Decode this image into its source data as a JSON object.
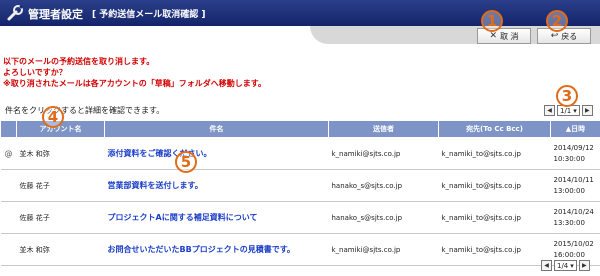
{
  "header": {
    "title": "管理者設定",
    "subtitle": "[ 予約送信メール取消確認 ]",
    "icon": "wrench-icon"
  },
  "buttons": {
    "cancel": "取 消",
    "back": "戻る"
  },
  "message": {
    "line1": "以下のメールの予約送信を取り消します。",
    "line2": "よろしいですか？",
    "line3": "※取り消されたメールは各アカウントの「草稿」フォルダへ移動します。"
  },
  "hint": "件名をクリックすると詳細を確認できます。",
  "pagination": {
    "value": "1/1"
  },
  "pagination_bottom": {
    "value": "1/4"
  },
  "columns": {
    "account": "アカウント名",
    "subject": "件名",
    "from": "送信者",
    "to": "宛先(To Cc Bcc)",
    "date": "▲日時"
  },
  "rows": [
    {
      "attach": "@",
      "account": "並木 和弥",
      "subject": "添付資料をご確認ください。",
      "from": "k_namiki@sjts.co.jp",
      "to": "k_namiki_to@sjts.co.jp",
      "date1": "2014/09/12",
      "date2": "10:30:00"
    },
    {
      "attach": "",
      "account": "佐藤 花子",
      "subject": "営業部資料を送付します。",
      "from": "hanako_s@sjts.co.jp",
      "to": "k_namiki_to@sjts.co.jp",
      "date1": "2014/10/11",
      "date2": "13:00:00"
    },
    {
      "attach": "",
      "account": "佐藤 花子",
      "subject": "プロジェクトAに関する補足資料について",
      "from": "hanako_s@sjts.co.jp",
      "to": "k_namiki_to@sjts.co.jp",
      "date1": "2014/10/24",
      "date2": "13:30:00"
    },
    {
      "attach": "",
      "account": "並木 和弥",
      "subject": "お問合せいただいたBBプロジェクトの見積書です。",
      "from": "k_namiki@sjts.co.jp",
      "to": "k_namiki_to@sjts.co.jp",
      "date1": "2015/10/02",
      "date2": "16:00:00"
    }
  ],
  "callouts": [
    "1",
    "2",
    "3",
    "4",
    "5"
  ],
  "colors": {
    "header": "#1a2c78",
    "accent": "#e06b18",
    "table_header": "#7e93c6",
    "link": "#1a3dc8",
    "warning": "#d10000"
  }
}
